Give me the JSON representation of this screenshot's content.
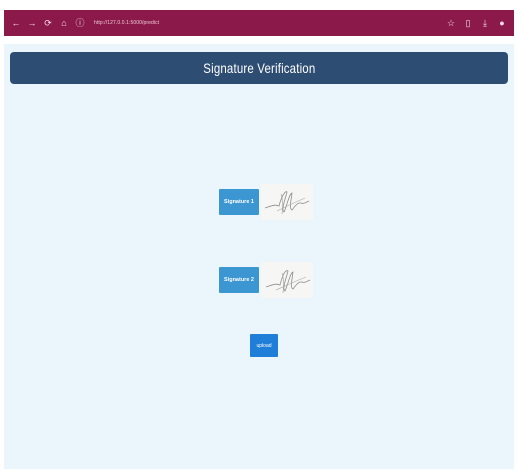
{
  "browser": {
    "back_icon": "←",
    "forward_icon": "→",
    "reload_icon": "⟳",
    "home_icon": "⌂",
    "info_icon": "ⓘ",
    "url": "http://127.0.0.1:5000/predict",
    "star_icon": "☆",
    "tab_icon": "▯",
    "download_icon": "⤓",
    "profile_icon": "●",
    "colors": {
      "bar": "#8b1a4a"
    }
  },
  "header": {
    "title": "Signature Verification",
    "color": "#2e4d73"
  },
  "signatures": [
    {
      "label": "Signature 1",
      "icon": "signature-image"
    },
    {
      "label": "Signature 2",
      "icon": "signature-image"
    }
  ],
  "upload": {
    "label": "upload",
    "color": "#1f7fd8"
  }
}
